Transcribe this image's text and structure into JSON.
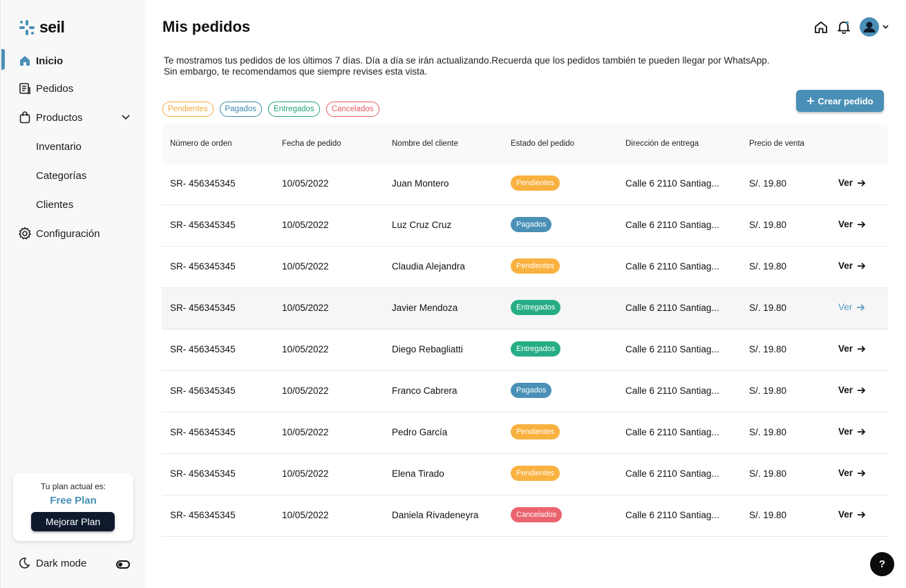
{
  "brand": {
    "name": "seil",
    "accent": "#4a90b6"
  },
  "sidebar": {
    "items": [
      {
        "label": "Inicio",
        "icon": "home-icon"
      },
      {
        "label": "Pedidos",
        "icon": "receipt-icon"
      },
      {
        "label": "Productos",
        "icon": "shopping-bag-icon"
      },
      {
        "label": "Inventario"
      },
      {
        "label": "Categorías"
      },
      {
        "label": "Clientes"
      },
      {
        "label": "Configuración",
        "icon": "gear-icon"
      }
    ],
    "plan": {
      "caption": "Tu plan actual es:",
      "name": "Free Plan",
      "button": "Mejorar Plan"
    },
    "dark_mode": "Dark mode"
  },
  "header": {
    "title": "Mis pedidos"
  },
  "intro": {
    "line1": "Te mostramos tus pedidos de los últimos 7 días. Día a día se irán actualizando.Recuerda que los pedidos también te pueden llegar por WhatsApp.",
    "line2": "Sin embargo, te recomendamos que siempre revises esta vista."
  },
  "filters": [
    {
      "label": "Pendientes",
      "color": "#f4a93b"
    },
    {
      "label": "Pagados",
      "color": "#4a90b6"
    },
    {
      "label": "Entregados",
      "color": "#2bb08b"
    },
    {
      "label": "Cancelados",
      "color": "#ec6a73"
    }
  ],
  "create_button": "Crear pedido",
  "table": {
    "headers": [
      "Número de orden",
      "Fecha de pedido",
      "Nombre del cliente",
      "Estado del pedido",
      "Dirección de entrega",
      "Precio de venta"
    ],
    "action_label": "Ver",
    "rows": [
      {
        "order": "SR- 456345345",
        "date": "10/05/2022",
        "client": "Juan Montero",
        "status": "Pendientes",
        "address": "Calle 6 2110 Santiag...",
        "price": "S/. 19.80"
      },
      {
        "order": "SR- 456345345",
        "date": "10/05/2022",
        "client": "Luz Cruz Cruz",
        "status": "Pagados",
        "address": "Calle 6 2110 Santiag...",
        "price": "S/. 19.80"
      },
      {
        "order": "SR- 456345345",
        "date": "10/05/2022",
        "client": "Claudia Alejandra",
        "status": "Pendientes",
        "address": "Calle 6 2110 Santiag...",
        "price": "S/. 19.80"
      },
      {
        "order": "SR- 456345345",
        "date": "10/05/2022",
        "client": "Javier Mendoza",
        "status": "Entregados",
        "address": "Calle 6 2110 Santiag...",
        "price": "S/. 19.80"
      },
      {
        "order": "SR- 456345345",
        "date": "10/05/2022",
        "client": "Diego Rebagliatti",
        "status": "Entregados",
        "address": "Calle 6 2110 Santiag...",
        "price": "S/. 19.80"
      },
      {
        "order": "SR- 456345345",
        "date": "10/05/2022",
        "client": "Franco Cabrera",
        "status": "Pagados",
        "address": "Calle 6 2110 Santiag...",
        "price": "S/. 19.80"
      },
      {
        "order": "SR- 456345345",
        "date": "10/05/2022",
        "client": "Pedro García",
        "status": "Pendientes",
        "address": "Calle 6 2110 Santiag...",
        "price": "S/. 19.80"
      },
      {
        "order": "SR- 456345345",
        "date": "10/05/2022",
        "client": "Elena Tirado",
        "status": "Pendientes",
        "address": "Calle 6 2110 Santiag...",
        "price": "S/. 19.80"
      },
      {
        "order": "SR- 456345345",
        "date": "10/05/2022",
        "client": "Daniela Rivadeneyra",
        "status": "Cancelados",
        "address": "Calle 6 2110 Santiag...",
        "price": "S/. 19.80"
      }
    ]
  },
  "status_colors": {
    "Pendientes": "#f9b13f",
    "Pagados": "#4a90b6",
    "Entregados": "#27ad85",
    "Cancelados": "#ea6470"
  },
  "help_label": "?"
}
